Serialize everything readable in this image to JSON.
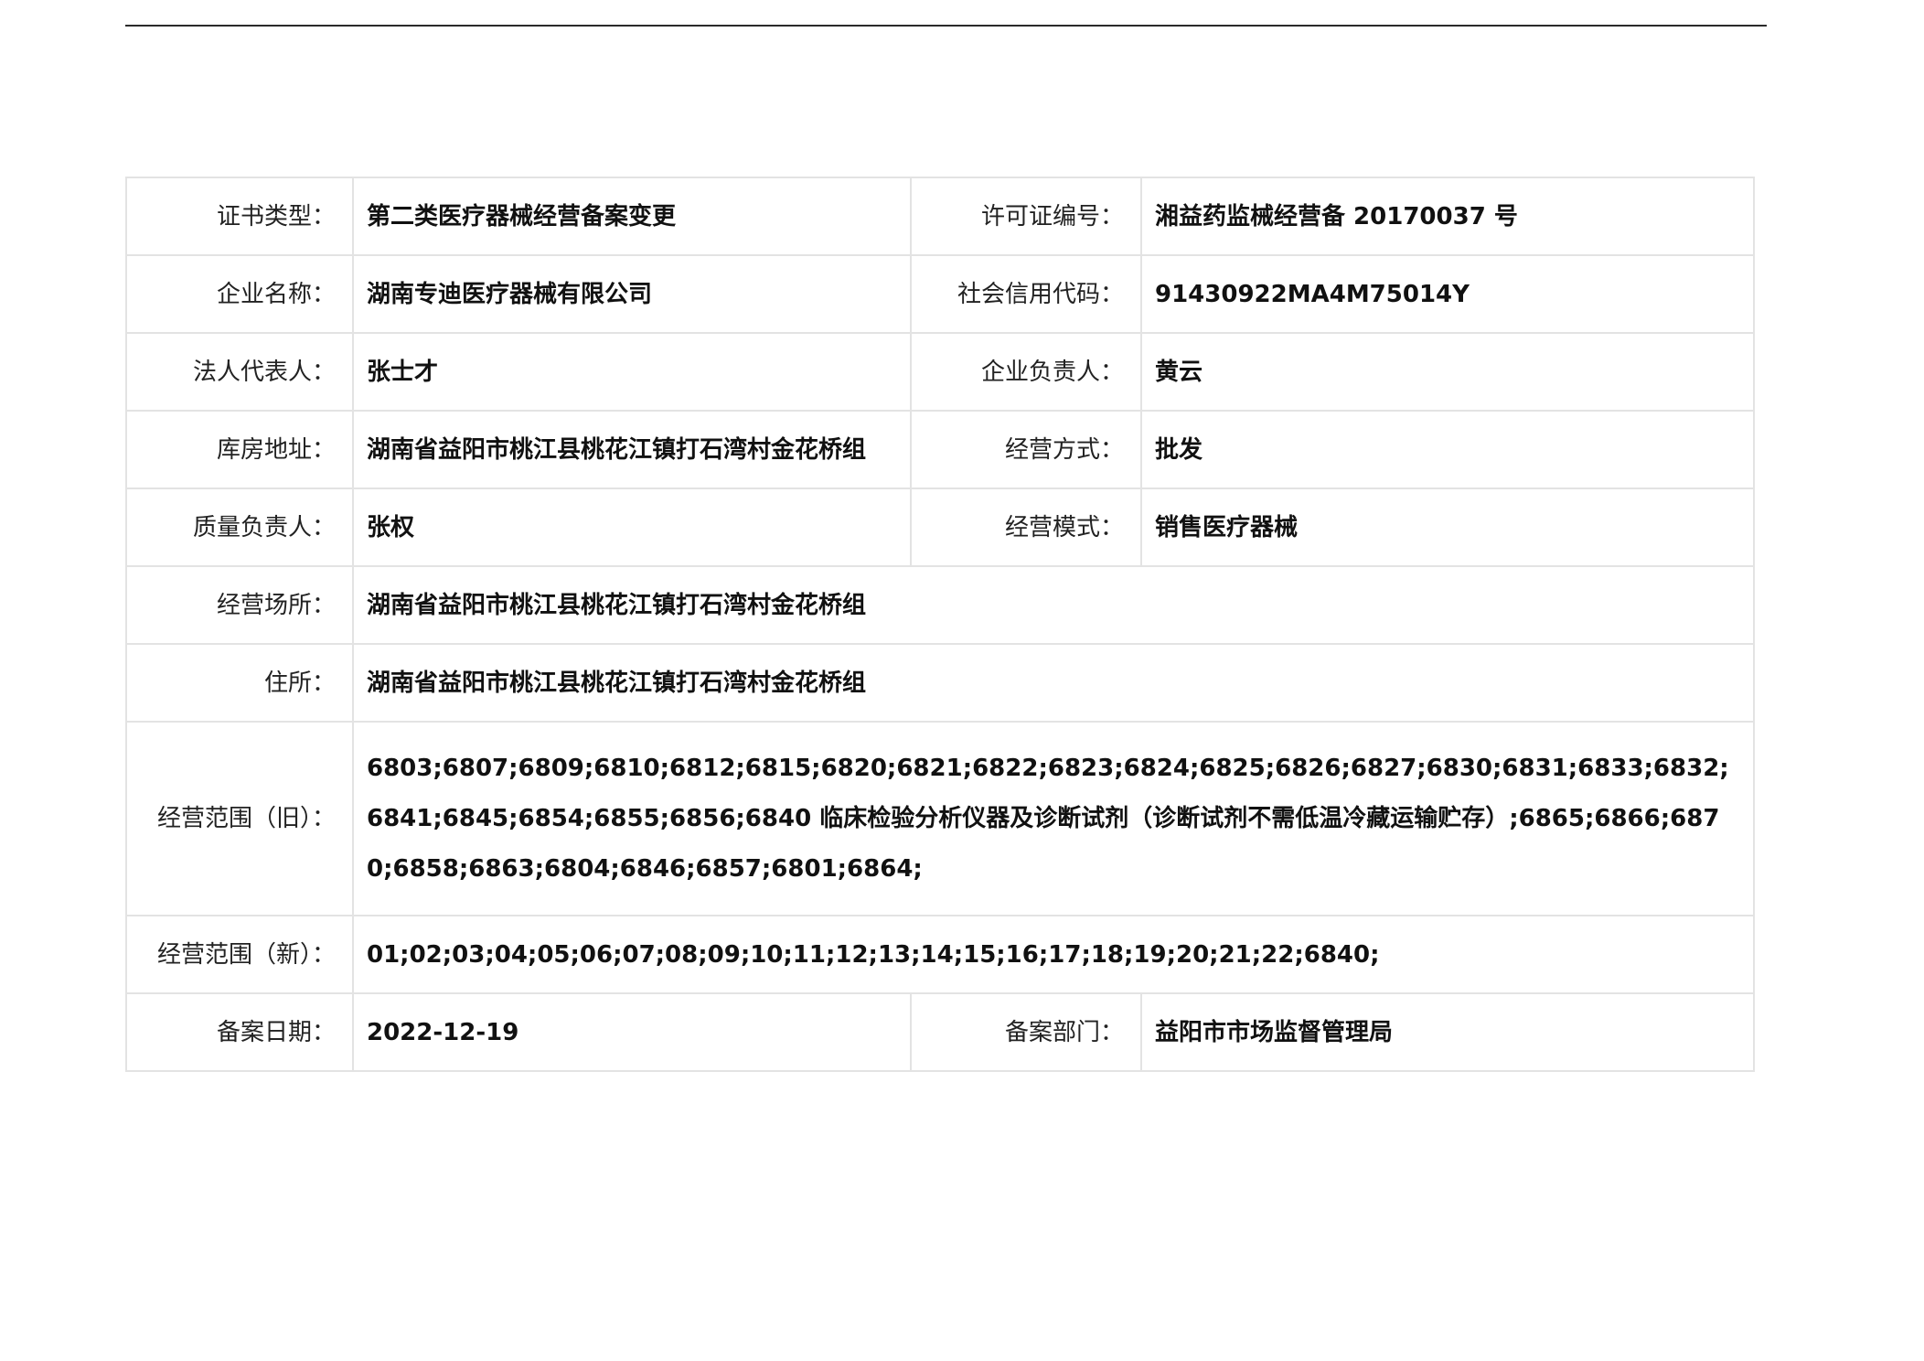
{
  "rows": {
    "cert_type": {
      "label": "证书类型：",
      "value": "第二类医疗器械经营备案变更"
    },
    "license_no": {
      "label": "许可证编号：",
      "value": "湘益药监械经营备 20170037 号"
    },
    "company_name": {
      "label": "企业名称：",
      "value": "湖南专迪医疗器械有限公司"
    },
    "credit_code": {
      "label": "社会信用代码：",
      "value": "91430922MA4M75014Y"
    },
    "legal_rep": {
      "label": "法人代表人：",
      "value": "张士才"
    },
    "company_head": {
      "label": "企业负责人：",
      "value": "黄云"
    },
    "warehouse_addr": {
      "label": "库房地址：",
      "value": "湖南省益阳市桃江县桃花江镇打石湾村金花桥组"
    },
    "business_method": {
      "label": "经营方式：",
      "value": "批发"
    },
    "quality_head": {
      "label": "质量负责人：",
      "value": "张权"
    },
    "business_mode": {
      "label": "经营模式：",
      "value": "销售医疗器械"
    },
    "business_premises": {
      "label": "经营场所：",
      "value": "湖南省益阳市桃江县桃花江镇打石湾村金花桥组"
    },
    "residence": {
      "label": "住所：",
      "value": "湖南省益阳市桃江县桃花江镇打石湾村金花桥组"
    },
    "scope_old": {
      "label": "经营范围（旧）：",
      "value": "6803;6807;6809;6810;6812;6815;6820;6821;6822;6823;6824;6825;6826;6827;6830;6831;6833;6832;6841;6845;6854;6855;6856;6840 临床检验分析仪器及诊断试剂（诊断试剂不需低温冷藏运输贮存）;6865;6866;6870;6858;6863;6804;6846;6857;6801;6864;"
    },
    "scope_new": {
      "label": "经营范围（新）：",
      "value": "01;02;03;04;05;06;07;08;09;10;11;12;13;14;15;16;17;18;19;20;21;22;6840;"
    },
    "record_date": {
      "label": "备案日期：",
      "value": "2022-12-19"
    },
    "record_dept": {
      "label": "备案部门：",
      "value": "益阳市市场监督管理局"
    }
  }
}
